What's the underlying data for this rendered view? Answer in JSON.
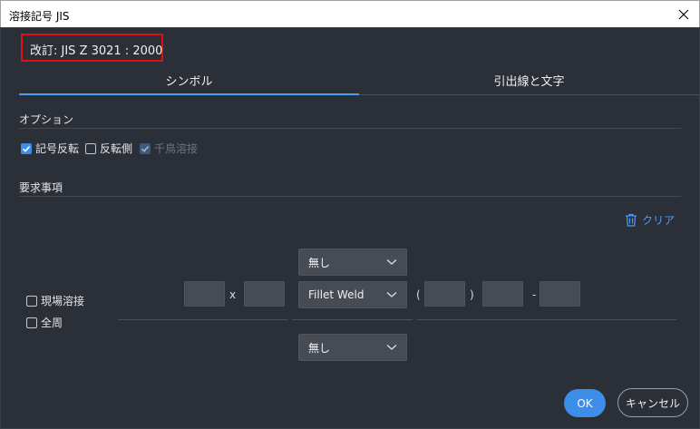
{
  "window": {
    "title": "溶接記号 JIS"
  },
  "revision": {
    "text": "改訂: JIS Z 3021 : 2000"
  },
  "tabs": [
    {
      "label": "シンボル",
      "active": true
    },
    {
      "label": "引出線と文字",
      "active": false
    }
  ],
  "options": {
    "heading": "オプション",
    "items": [
      {
        "label": "記号反転",
        "checked": true,
        "enabled": true
      },
      {
        "label": "反転側",
        "checked": false,
        "enabled": true
      },
      {
        "label": "千鳥溶接",
        "checked": true,
        "enabled": false
      }
    ]
  },
  "requirements": {
    "heading": "要求事項",
    "clear_label": "クリア",
    "field_weld_label": "現場溶接",
    "all_around_label": "全周",
    "size_sep": "x",
    "paren_open": "(",
    "paren_close": ")",
    "dash": "-",
    "contour_top": "無し",
    "weld_type": "Fillet Weld",
    "contour_bottom": "無し"
  },
  "buttons": {
    "ok": "OK",
    "cancel": "キャンセル"
  },
  "colors": {
    "accent": "#3d8ee8",
    "highlight_box": "#e01010",
    "background": "#2b2f37"
  }
}
